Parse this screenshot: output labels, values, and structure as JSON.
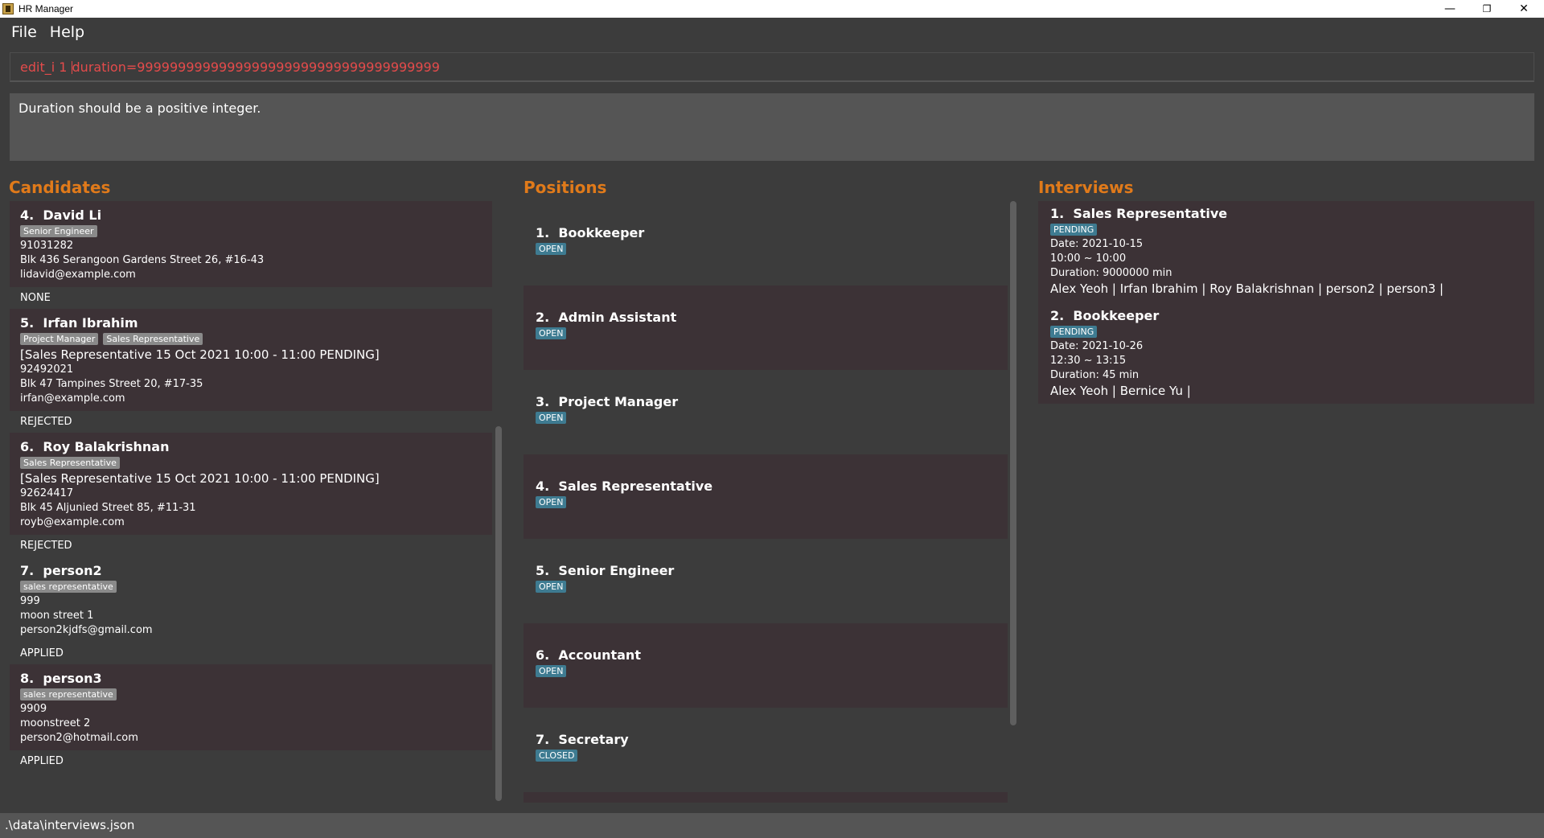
{
  "window": {
    "title": "HR Manager",
    "minimize": "—",
    "maximize": "❐",
    "close": "✕"
  },
  "menu": {
    "file": "File",
    "help": "Help"
  },
  "command": {
    "before_cursor": "edit_i 1 ",
    "after_cursor": "duration=9999999999999999999999999999999999999"
  },
  "result": {
    "message": "Duration should be a positive integer."
  },
  "candidates": {
    "title": "Candidates",
    "items": [
      {
        "index": "4.",
        "name": "David Li",
        "tags": [
          "Senior Engineer"
        ],
        "interview": "",
        "phone": "91031282",
        "address": "Blk 436 Serangoon Gardens Street 26, #16-43",
        "email": "lidavid@example.com",
        "status": "NONE"
      },
      {
        "index": "5.",
        "name": "Irfan Ibrahim",
        "tags": [
          "Project Manager",
          "Sales Representative"
        ],
        "interview": "[Sales Representative 15 Oct 2021 10:00 - 11:00 PENDING]",
        "phone": "92492021",
        "address": "Blk 47 Tampines Street 20, #17-35",
        "email": "irfan@example.com",
        "status": "REJECTED"
      },
      {
        "index": "6.",
        "name": "Roy Balakrishnan",
        "tags": [
          "Sales Representative"
        ],
        "interview": "[Sales Representative 15 Oct 2021 10:00 - 11:00 PENDING]",
        "phone": "92624417",
        "address": "Blk 45 Aljunied Street 85, #11-31",
        "email": "royb@example.com",
        "status": "REJECTED"
      },
      {
        "index": "7.",
        "name": "person2",
        "tags": [
          "sales representative"
        ],
        "interview": "",
        "phone": "999",
        "address": "moon street 1",
        "email": "person2kjdfs@gmail.com",
        "status": "APPLIED"
      },
      {
        "index": "8.",
        "name": "person3",
        "tags": [
          "sales representative"
        ],
        "interview": "",
        "phone": "9909",
        "address": "moonstreet 2",
        "email": "person2@hotmail.com",
        "status": "APPLIED"
      }
    ]
  },
  "positions": {
    "title": "Positions",
    "items": [
      {
        "index": "1.",
        "name": "Bookkeeper",
        "status": "OPEN"
      },
      {
        "index": "2.",
        "name": "Admin Assistant",
        "status": "OPEN"
      },
      {
        "index": "3.",
        "name": "Project Manager",
        "status": "OPEN"
      },
      {
        "index": "4.",
        "name": "Sales Representative",
        "status": "OPEN"
      },
      {
        "index": "5.",
        "name": "Senior Engineer",
        "status": "OPEN"
      },
      {
        "index": "6.",
        "name": "Accountant",
        "status": "OPEN"
      },
      {
        "index": "7.",
        "name": "Secretary",
        "status": "CLOSED"
      }
    ]
  },
  "interviews": {
    "title": "Interviews",
    "items": [
      {
        "index": "1.",
        "position": "Sales Representative",
        "status": "PENDING",
        "date": "Date: 2021-10-15",
        "time": "10:00 ~ 10:00",
        "duration": "Duration: 9000000 min",
        "candidates": "Alex Yeoh | Irfan Ibrahim | Roy Balakrishnan | person2 | person3 |"
      },
      {
        "index": "2.",
        "position": "Bookkeeper",
        "status": "PENDING",
        "date": "Date: 2021-10-26",
        "time": "12:30 ~ 13:15",
        "duration": "Duration: 45 min",
        "candidates": "Alex Yeoh | Bernice Yu |"
      }
    ]
  },
  "statusbar": {
    "path": ".\\data\\interviews.json"
  }
}
